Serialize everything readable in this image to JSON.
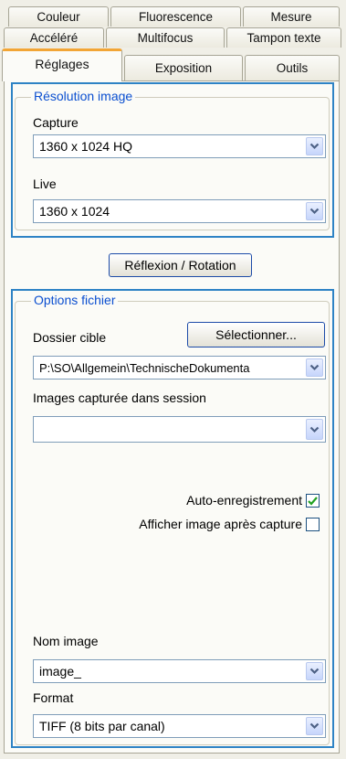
{
  "tabs": {
    "row1": [
      "Couleur",
      "Fluorescence",
      "Mesure"
    ],
    "row2": [
      "Accéléré",
      "Multifocus",
      "Tampon texte"
    ],
    "row3": [
      "Réglages",
      "Exposition",
      "Outils"
    ],
    "active": "Réglages"
  },
  "resolution": {
    "legend": "Résolution image",
    "capture_label": "Capture",
    "capture_value": "1360 x 1024 HQ",
    "live_label": "Live",
    "live_value": "1360 x 1024"
  },
  "reflexion_button": "Réflexion / Rotation",
  "options": {
    "legend": "Options fichier",
    "dossier_label": "Dossier cible",
    "select_button": "Sélectionner...",
    "dossier_value": "P:\\SO\\Allgemein\\TechnischeDokumenta",
    "images_label": "Images capturée dans session",
    "images_value": "",
    "auto_save_label": "Auto-enregistrement",
    "auto_save_checked": true,
    "show_after_label": "Afficher image après capture",
    "show_after_checked": false,
    "name_label": "Nom image",
    "name_value": "image_",
    "format_label": "Format",
    "format_value": "TIFF (8 bits par canal)"
  },
  "colors": {
    "highlight": "#2e83c5",
    "active_tab_accent": "#f2a536",
    "legend_text": "#0b4fd0"
  }
}
